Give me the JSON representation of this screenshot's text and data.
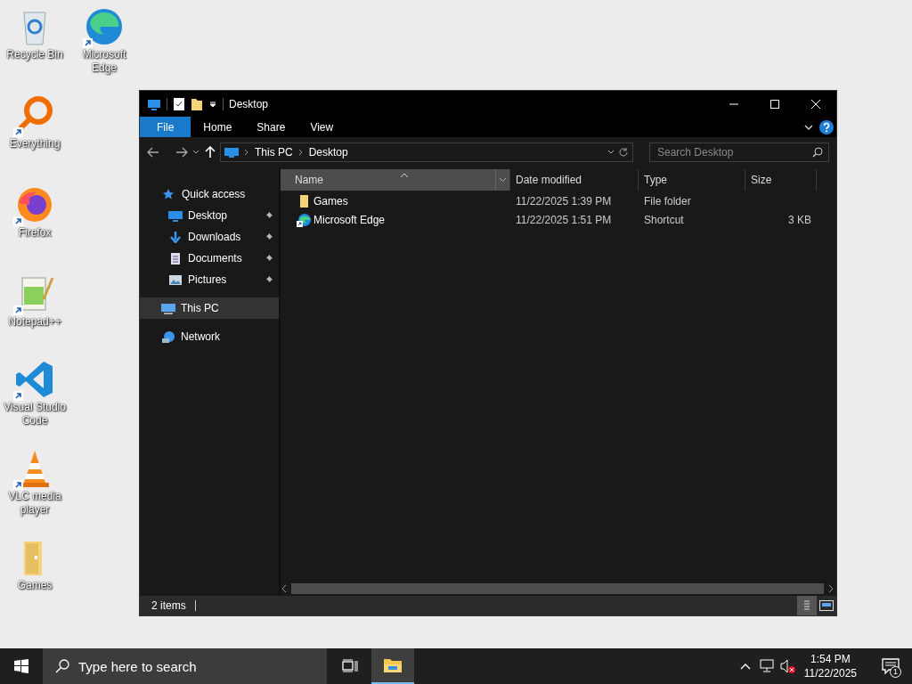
{
  "desktop": {
    "icons": [
      {
        "label": "Recycle Bin",
        "shortcut": false
      },
      {
        "label": "Microsoft Edge",
        "shortcut": true
      },
      {
        "label": "Everything",
        "shortcut": true
      },
      {
        "label": "Firefox",
        "shortcut": true
      },
      {
        "label": "Notepad++",
        "shortcut": true
      },
      {
        "label": "Visual Studio Code",
        "shortcut": true
      },
      {
        "label": "VLC media player",
        "shortcut": true
      },
      {
        "label": "Games",
        "shortcut": false
      }
    ]
  },
  "window": {
    "title": "Desktop",
    "ribbon_tabs": [
      {
        "label": "File",
        "selected": true
      },
      {
        "label": "Home",
        "selected": false
      },
      {
        "label": "Share",
        "selected": false
      },
      {
        "label": "View",
        "selected": false
      }
    ],
    "address": {
      "path": [
        "This PC",
        "Desktop"
      ]
    },
    "search": {
      "placeholder": "Search Desktop"
    },
    "nav": [
      {
        "label": "Quick access",
        "selected": false,
        "children": [
          {
            "label": "Desktop",
            "pinned": true,
            "selected": false
          },
          {
            "label": "Downloads",
            "pinned": true,
            "selected": false
          },
          {
            "label": "Documents",
            "pinned": true,
            "selected": false
          },
          {
            "label": "Pictures",
            "pinned": true,
            "selected": false
          }
        ]
      },
      {
        "label": "This PC",
        "selected": true
      },
      {
        "label": "Network",
        "selected": false
      }
    ],
    "columns": [
      {
        "label": "Name",
        "sorted": true
      },
      {
        "label": "Date modified",
        "sorted": false
      },
      {
        "label": "Type",
        "sorted": false
      },
      {
        "label": "Size",
        "sorted": false
      }
    ],
    "rows": [
      {
        "kind": "folder",
        "name": "Games",
        "date": "11/22/2025 1:39 PM",
        "type": "File folder"
      },
      {
        "kind": "shortcut",
        "name": "Microsoft Edge",
        "date": "11/22/2025 1:51 PM",
        "type": "Shortcut",
        "size": "3 KB"
      }
    ],
    "status": "2 items"
  },
  "taskbar": {
    "search_placeholder": "Type here to search",
    "time": "1:54 PM",
    "date": "11/22/2025",
    "notifications": "1"
  }
}
